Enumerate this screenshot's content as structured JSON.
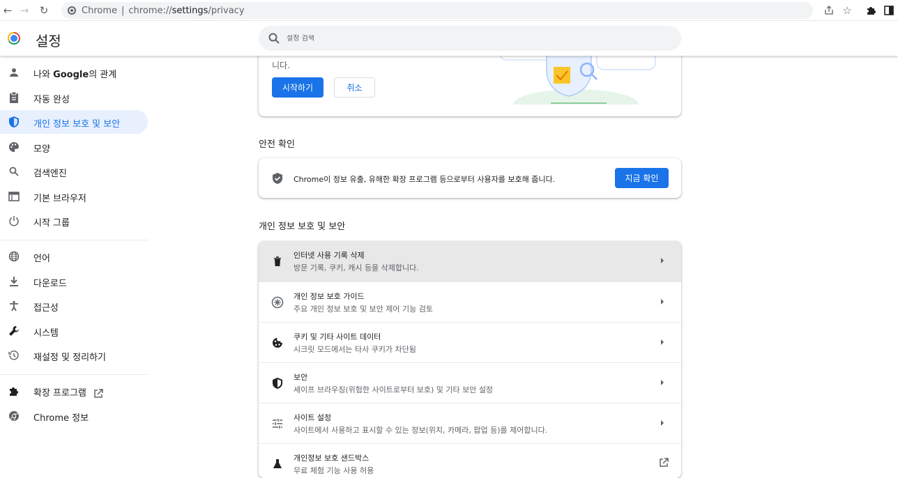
{
  "browser": {
    "site_chip": "Chrome",
    "url_prefix": "chrome://",
    "url_host": "settings",
    "url_path": "/privacy"
  },
  "header": {
    "title": "설정",
    "search_placeholder": "설정 검색"
  },
  "sidebar": {
    "items": [
      {
        "label_bold": "나와 ",
        "label": "나와 Google의 관계",
        "icon": "person-icon"
      },
      {
        "label": "자동 완성",
        "icon": "clipboard-icon"
      },
      {
        "label": "개인 정보 보호 및 보안",
        "icon": "shield-icon",
        "active": true
      },
      {
        "label": "모양",
        "icon": "palette-icon"
      },
      {
        "label": "검색엔진",
        "icon": "search-icon"
      },
      {
        "label": "기본 브라우저",
        "icon": "browser-window-icon"
      },
      {
        "label": "시작 그룹",
        "icon": "power-icon"
      },
      {
        "label": "언어",
        "icon": "globe-icon"
      },
      {
        "label": "다운로드",
        "icon": "download-icon"
      },
      {
        "label": "접근성",
        "icon": "accessibility-icon"
      },
      {
        "label": "시스템",
        "icon": "wrench-icon"
      },
      {
        "label": "재설정 및 정리하기",
        "icon": "history-icon"
      },
      {
        "label": "확장 프로그램",
        "icon": "puzzle-icon"
      },
      {
        "label": "Chrome 정보",
        "icon": "chrome-icon"
      }
    ],
    "google_prefix": "나와 ",
    "google_word": "Google",
    "google_suffix": "의 관계",
    "about_word": "Chrome",
    "about_suffix": " 정보"
  },
  "main": {
    "top_card": {
      "cut_text": "니다.",
      "start_label": "시작하기",
      "cancel_label": "취소"
    },
    "safety": {
      "section_title": "안전 확인",
      "text": "Chrome이 정보 유출, 유해한 확장 프로그램 등으로부터 사용자를 보호해 줍니다.",
      "button_label": "지금 확인"
    },
    "privacy": {
      "section_title": "개인 정보 보호 및 보안",
      "rows": [
        {
          "title": "인터넷 사용 기록 삭제",
          "subtitle": "방문 기록, 쿠키, 캐시 등을 삭제합니다."
        },
        {
          "title": "개인 정보 보호 가이드",
          "subtitle": "주요 개인 정보 보호 및 보안 제어 기능 검토"
        },
        {
          "title": "쿠키 및 기타 사이트 데이터",
          "subtitle": "시크릿 모드에서는 타사 쿠키가 차단됨"
        },
        {
          "title": "보안",
          "subtitle": "세이프 브라우징(위험한 사이트로부터 보호) 및 기타 보안 설정"
        },
        {
          "title": "사이트 설정",
          "subtitle": "사이트에서 사용하고 표시할 수 있는 정보(위치, 카메라, 팝업 등)를 제어합니다."
        },
        {
          "title": "개인정보 보호 샌드박스",
          "subtitle": "무료 체험 기능 사용 허용"
        }
      ]
    }
  },
  "colors": {
    "accent": "#1a73e8",
    "active_bg": "#e8f0fe",
    "icon_gray": "#5f6368"
  }
}
